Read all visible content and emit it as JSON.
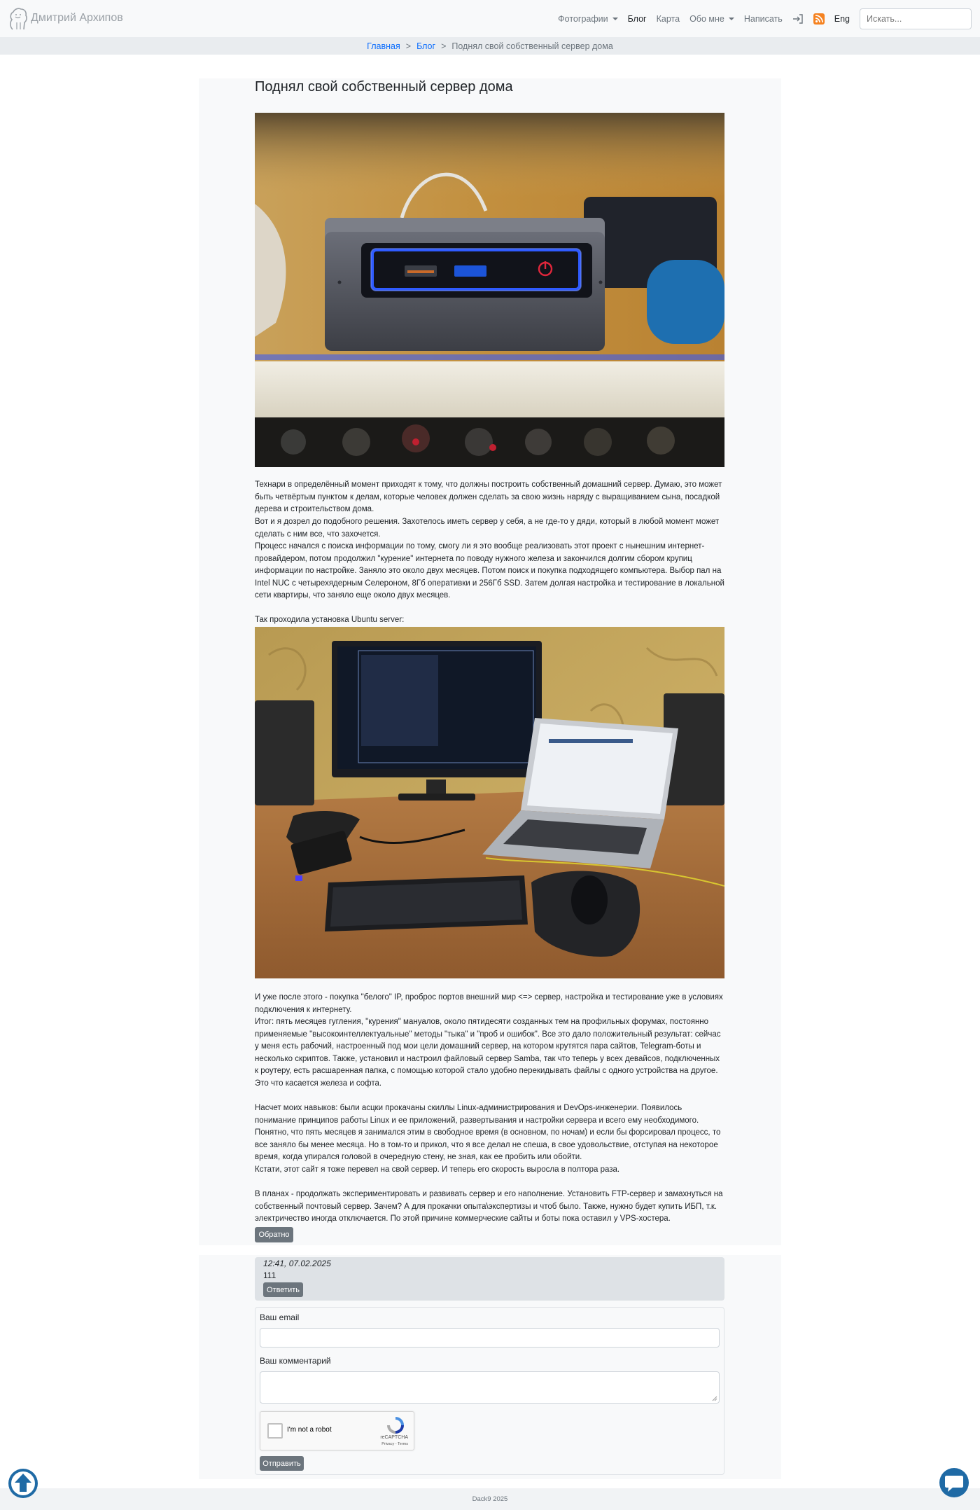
{
  "brand": {
    "name": "Дмитрий Архипов"
  },
  "nav": {
    "photos": "Фотографии",
    "blog": "Блог",
    "map": "Карта",
    "about": "Обо мне",
    "write": "Написать",
    "lang": "Eng",
    "search_placeholder": "Искать..."
  },
  "breadcrumb": {
    "home": "Главная",
    "blog": "Блог",
    "current": "Поднял свой собственный сервер дома",
    "separator": ">"
  },
  "article": {
    "title": "Поднял свой собственный сервер дома",
    "paragraphs": [
      "Технари в определённый момент приходят к тому, что должны построить собственный домашний сервер. Думаю, это может быть четвёртым пунктом к делам, которые человек должен сделать за свою жизнь наряду с выращиванием сына, посадкой дерева и строительством дома.",
      "Вот и я дозрел до подобного решения. Захотелось иметь сервер у себя, а не где-то у дяди, который в любой момент может сделать с ним все, что захочется.",
      "Процесс начался с поиска информации по тому, смогу ли я это вообще реализовать этот проект с нынешним интернет-провайдером, потом продолжил \"курение\" интернета по поводу нужного железа и закончился долгим сбором крупиц информации по настройке. Заняло это около двух месяцев. Потом поиск и покупка подходящего компьютера. Выбор пал на Intel NUC с четырехядерным Селероном, 8Гб оперативки и 256Гб SSD. Затем долгая настройка и тестирование в локальной сети квартиры, что заняло еще около двух месяцев.",
      "Так проходила установка Ubuntu server:",
      "И уже после этого - покупка \"белого\" IP, проброс портов внешний мир <=> сервер, настройка и тестирование уже в условиях подключения к интернету.",
      "Итог: пять месяцев гугления, \"курения\" мануалов, около пятидесяти созданных тем на профильных форумах, постоянно применяемые \"высокоинтеллектуальные\" методы \"тыка\" и \"проб и ошибок\". Все это дало положительный результат: сейчас у меня есть рабочий, настроенный под мои цели домашний сервер, на котором крутятся пара сайтов, Telegram-боты и несколько скриптов. Также, установил и настроил файловый сервер Samba, так что теперь у всех девайсов, подключенных к роутеру, есть расшаренная папка, с помощью которой стало удобно перекидывать файлы с одного устройства на другое. Это что касается железа и софта.",
      "Насчет моих навыков: были acцки прокачаны скиллы Linux-администрирования и DevOps-инженерии. Появилось понимание принципов работы Linux и ее приложений, развертывания и настройки сервера и всего ему необходимого. Понятно, что пять месяцев я занимался этим в свободное время (в основном, по ночам) и если бы форсировал процесс, то все заняло бы менее месяца. Но в том-то и прикол, что я все делал не спеша, в свое удовольствие, отступая на некоторое время, когда упирался головой в очередную стену, не зная, как ее пробить или обойти.",
      "Кстати, этот сайт я тоже перевел на свой сервер. И теперь его скорость выросла в полтора раза.",
      "В планах - продолжать экспериментировать и развивать сервер и его наполнение. Установить FTP-сервер и замахнуться на собственный почтовый сервер. Зачем? А для прокачки опыта\\экспертизы и чтоб было. Также, нужно будет купить ИБП, т.к. электричество иногда отключается. По этой причине коммерческие сайты и боты пока оставил у VPS-хостера."
    ],
    "back_button": "Обратно"
  },
  "comments": {
    "items": [
      {
        "date": "12:41, 07.02.2025",
        "text": "111",
        "reply": "Ответить"
      }
    ],
    "form": {
      "email_label": "Ваш email",
      "comment_label": "Ваш комментарий",
      "submit": "Отправить"
    },
    "recaptcha": {
      "label": "I'm not a robot",
      "brand": "reCAPTCHA",
      "terms": "Privacy - Terms"
    }
  },
  "footer": {
    "text": "Dack9 2025"
  },
  "colors": {
    "link": "#0d6efd",
    "button": "#6c757d",
    "rss": "#f58220",
    "float_button": "#1f6aa5"
  }
}
